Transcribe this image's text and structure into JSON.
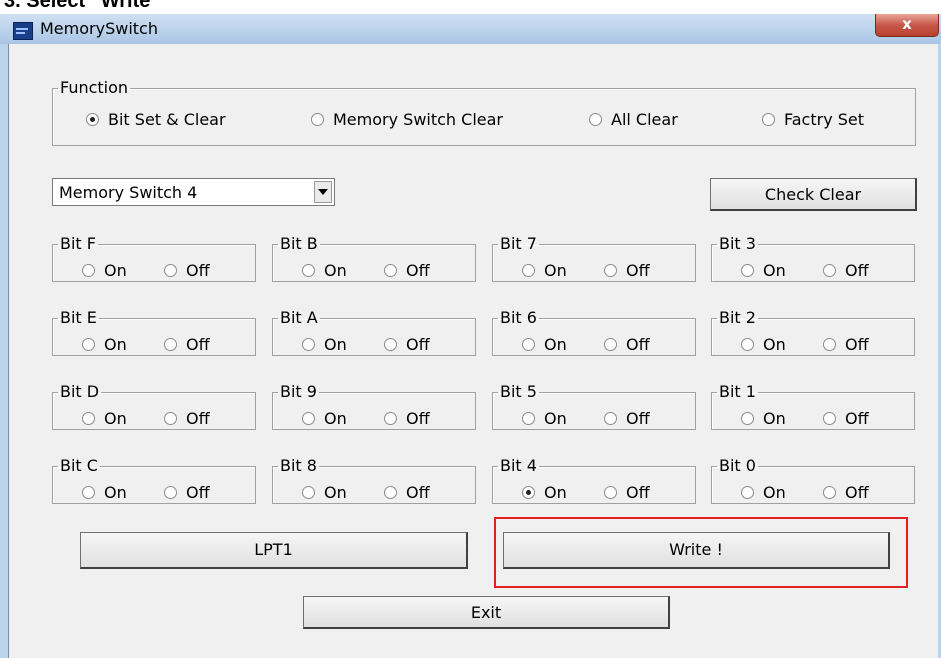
{
  "top_crop_text": "3. Select “Write”",
  "window": {
    "title": "MemorySwitch",
    "close_glyph": "x"
  },
  "function_group": {
    "legend": "Function",
    "options": [
      {
        "label": "Bit Set & Clear",
        "selected": true
      },
      {
        "label": "Memory Switch Clear",
        "selected": false
      },
      {
        "label": "All Clear",
        "selected": false
      },
      {
        "label": "Factry Set",
        "selected": false
      }
    ]
  },
  "memory_switch_select": {
    "value": "Memory Switch 4"
  },
  "check_clear_label": "Check Clear",
  "on_label": "On",
  "off_label": "Off",
  "bits": [
    {
      "name": "Bit F",
      "state": "none"
    },
    {
      "name": "Bit B",
      "state": "none"
    },
    {
      "name": "Bit 7",
      "state": "none"
    },
    {
      "name": "Bit 3",
      "state": "none"
    },
    {
      "name": "Bit E",
      "state": "none"
    },
    {
      "name": "Bit A",
      "state": "none"
    },
    {
      "name": "Bit 6",
      "state": "none"
    },
    {
      "name": "Bit 2",
      "state": "none"
    },
    {
      "name": "Bit D",
      "state": "none"
    },
    {
      "name": "Bit 9",
      "state": "none"
    },
    {
      "name": "Bit 5",
      "state": "none"
    },
    {
      "name": "Bit 1",
      "state": "none"
    },
    {
      "name": "Bit C",
      "state": "none"
    },
    {
      "name": "Bit 8",
      "state": "none"
    },
    {
      "name": "Bit 4",
      "state": "on"
    },
    {
      "name": "Bit 0",
      "state": "none"
    }
  ],
  "buttons": {
    "port": "LPT1",
    "write": "Write !",
    "exit": "Exit"
  },
  "colors": {
    "highlight": "#e12020"
  }
}
